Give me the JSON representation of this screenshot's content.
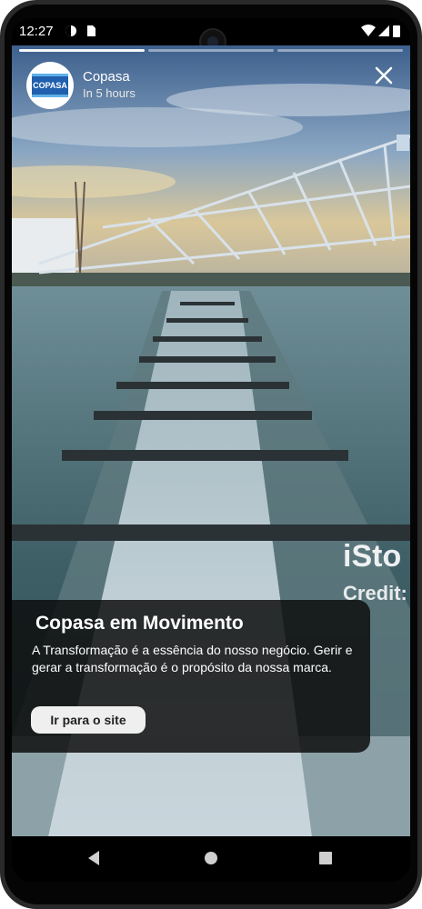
{
  "status_bar": {
    "time": "12:27"
  },
  "story": {
    "account_name": "Copasa",
    "time_label": "In 5 hours",
    "logo_text": "COPASA",
    "progress_segments": 3,
    "active_segment": 0
  },
  "watermark": {
    "line1": "iSto",
    "line2": "Credit:"
  },
  "card": {
    "title": "Copasa em Movimento",
    "body": "A Transformação é a essência do nosso negócio. Gerir e gerar a transformação é o propósito da nossa marca.",
    "button_label": "Ir para o site"
  },
  "icons": {
    "close": "close-icon",
    "back": "back-nav-icon",
    "home": "home-nav-icon",
    "recents": "recents-nav-icon"
  },
  "colors": {
    "brand_blue": "#1f5fae",
    "card_bg": "#0c0c0c"
  }
}
